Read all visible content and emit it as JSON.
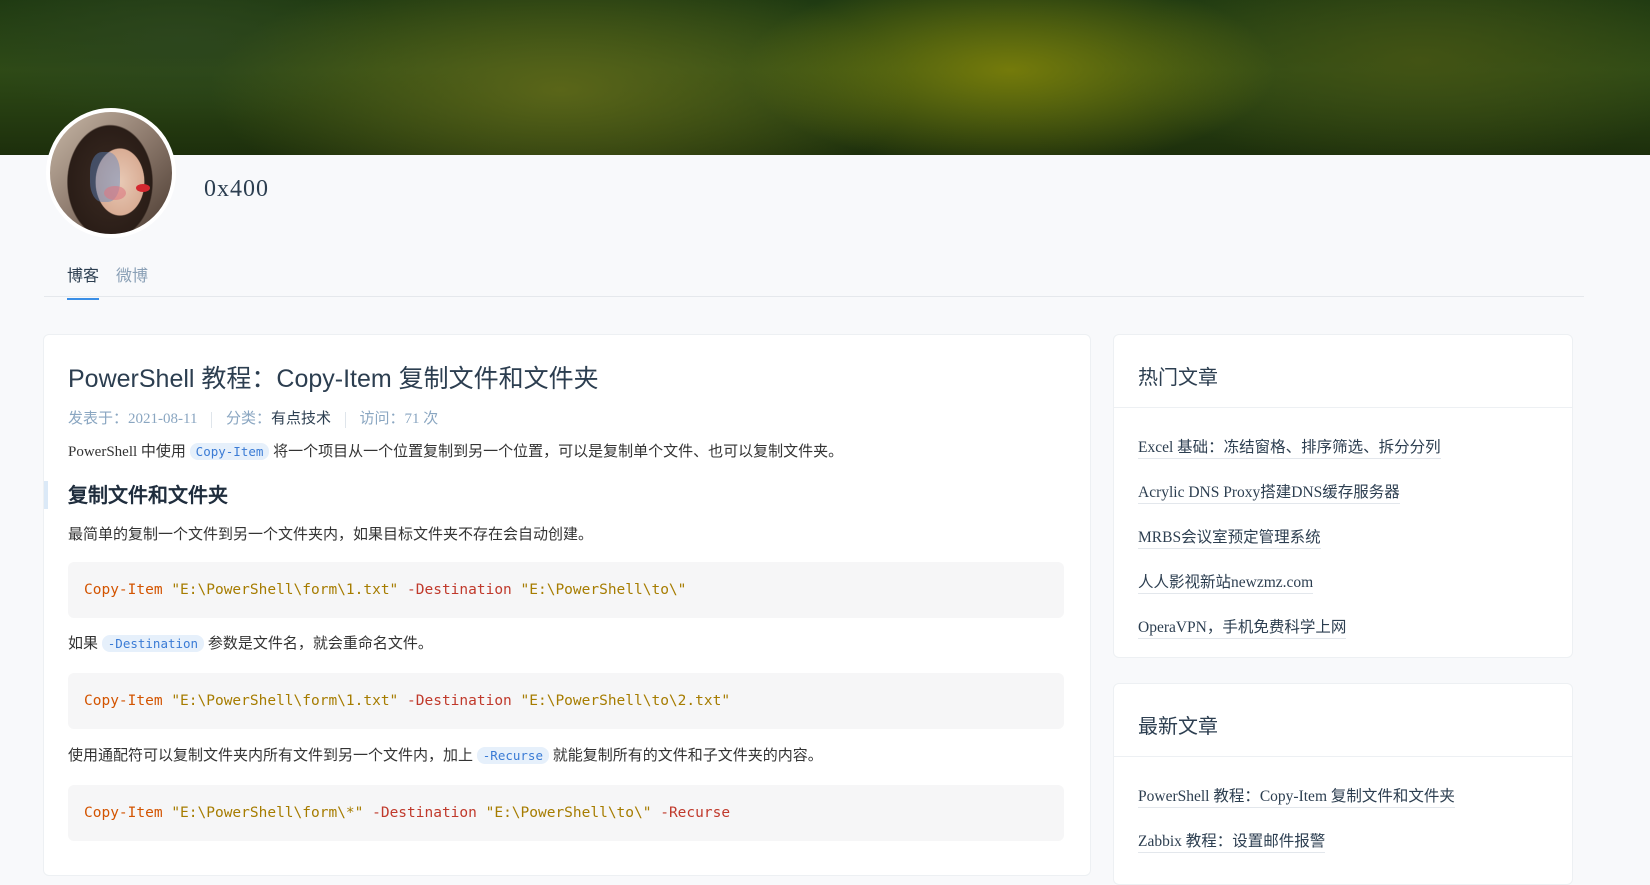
{
  "profile": {
    "username": "0x400"
  },
  "tabs": [
    {
      "label": "博客",
      "active": true
    },
    {
      "label": "微博",
      "active": false
    }
  ],
  "post": {
    "title": "PowerShell 教程：Copy-Item 复制文件和文件夹",
    "meta": {
      "published_label": "发表于：",
      "published_date": "2021-08-11",
      "category_label": "分类：",
      "category": "有点技术",
      "visits_label": "访问：",
      "visits": "71 次"
    },
    "intro": {
      "before": "PowerShell 中使用",
      "code": "Copy-Item",
      "after": "将一个项目从一个位置复制到另一个位置，可以是复制单个文件、也可以复制文件夹。"
    },
    "heading": "复制文件和文件夹",
    "p1": "最简单的复制一个文件到另一个文件夹内，如果目标文件夹不存在会自动创建。",
    "code1": {
      "cmd": "Copy-Item",
      "src": "\"E:\\PowerShell\\form\\1.txt\"",
      "flag": "-Destination",
      "dst": "\"E:\\PowerShell\\to\\\""
    },
    "p2": {
      "before": "如果",
      "code": "-Destination",
      "after": "参数是文件名，就会重命名文件。"
    },
    "code2": {
      "cmd": "Copy-Item",
      "src": "\"E:\\PowerShell\\form\\1.txt\"",
      "flag": "-Destination",
      "dst": "\"E:\\PowerShell\\to\\2.txt\""
    },
    "p3": {
      "before": "使用通配符可以复制文件夹内所有文件到另一个文件内，加上",
      "code": "-Recurse",
      "after": "就能复制所有的文件和子文件夹的内容。"
    },
    "code3": {
      "cmd": "Copy-Item",
      "src": "\"E:\\PowerShell\\form\\*\"",
      "flag": "-Destination",
      "dst": "\"E:\\PowerShell\\to\\\"",
      "flag2": "-Recurse"
    }
  },
  "sidebar": {
    "hot": {
      "title": "热门文章",
      "items": [
        "Excel 基础：冻结窗格、排序筛选、拆分分列",
        "Acrylic DNS Proxy搭建DNS缓存服务器",
        "MRBS会议室预定管理系统",
        "人人影视新站newzmz.com",
        "OperaVPN，手机免费科学上网"
      ]
    },
    "latest": {
      "title": "最新文章",
      "items": [
        "PowerShell 教程：Copy-Item 复制文件和文件夹",
        "Zabbix 教程：设置邮件报警"
      ]
    }
  },
  "colors": {
    "accent": "#3a8ee6",
    "code_text": "#b07a2a",
    "muted": "#8aa6c1"
  }
}
